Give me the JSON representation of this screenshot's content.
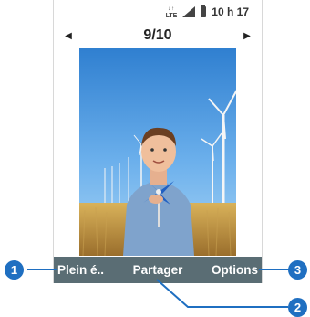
{
  "status_bar": {
    "network": "LTE",
    "time": "10 h 17"
  },
  "viewer": {
    "counter": "9/10",
    "prev_icon": "left-triangle",
    "next_icon": "right-triangle"
  },
  "photo": {
    "subject": "boy-with-pinwheel-wind-turbines-field"
  },
  "softkeys": {
    "left": "Plein é..",
    "center": "Partager",
    "right": "Options"
  },
  "callouts": {
    "one": "1",
    "two": "2",
    "three": "3",
    "color": "#1f6fc1"
  }
}
